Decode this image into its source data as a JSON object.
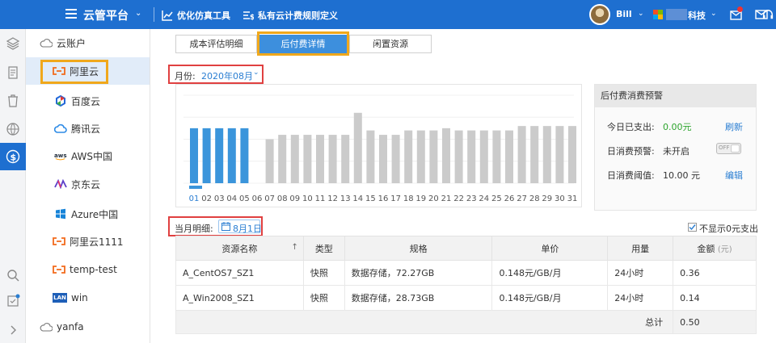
{
  "topbar": {
    "app_title": "云管平台",
    "tools": [
      {
        "label": "优化仿真工具",
        "icon": "chart-line-icon"
      },
      {
        "label": "私有云计费规则定义",
        "icon": "rule-list-icon"
      }
    ],
    "user_name": "Bill",
    "org_suffix": "科技"
  },
  "tree": {
    "root": "云账户",
    "items": [
      {
        "label": "阿里云",
        "icon": "aliyun-icon",
        "selected": true
      },
      {
        "label": "百度云",
        "icon": "baidu-cloud-icon"
      },
      {
        "label": "腾讯云",
        "icon": "tencent-cloud-icon"
      },
      {
        "label": "AWS中国",
        "icon": "aws-icon"
      },
      {
        "label": "京东云",
        "icon": "jd-cloud-icon"
      },
      {
        "label": "Azure中国",
        "icon": "azure-icon"
      },
      {
        "label": "阿里云1111",
        "icon": "aliyun-icon"
      },
      {
        "label": "temp-test",
        "icon": "aliyun-icon"
      },
      {
        "label": "win",
        "icon": "lan-icon"
      }
    ],
    "root2": "yanfa",
    "lan_text": "LAN"
  },
  "tabs": [
    {
      "label": "成本评估明细",
      "active": false
    },
    {
      "label": "后付费详情",
      "active": true
    },
    {
      "label": "闲置资源",
      "active": false
    }
  ],
  "month": {
    "label": "月份:",
    "value": "2020年08月"
  },
  "chart_data": {
    "type": "bar",
    "categories": [
      "01",
      "02",
      "03",
      "04",
      "05",
      "06",
      "07",
      "08",
      "09",
      "10",
      "11",
      "12",
      "13",
      "14",
      "15",
      "16",
      "17",
      "18",
      "19",
      "20",
      "21",
      "22",
      "23",
      "24",
      "25",
      "26",
      "27",
      "28",
      "29",
      "30",
      "31"
    ],
    "values": [
      0.5,
      0.5,
      0.5,
      0.5,
      0.5,
      0,
      0.4,
      0.44,
      0.44,
      0.44,
      0.44,
      0.44,
      0.44,
      0.64,
      0.48,
      0.44,
      0.44,
      0.48,
      0.48,
      0.48,
      0.5,
      0.48,
      0.48,
      0.48,
      0.48,
      0.48,
      0.52,
      0.52,
      0.52,
      0.52,
      0.52
    ],
    "highlighted_count": 5,
    "selected_category": "01",
    "colors": {
      "active": "#3b95db",
      "inactive": "#cbcbcb",
      "selected_label": "#2a7ed2",
      "label": "#555555"
    },
    "grid": true
  },
  "warning": {
    "title": "后付费消费预警",
    "rows": [
      {
        "key": "今日已支出:",
        "value": "0.00元",
        "action": "刷新"
      },
      {
        "key": "日消费预警:",
        "value": "未开启",
        "toggle_text": "OFF"
      },
      {
        "key": "日消费阈值:",
        "value": "10.00 元",
        "action": "编辑"
      }
    ]
  },
  "detail": {
    "label": "当月明细:",
    "date": "8月1日",
    "hide_zero_label": "不显示0元支出",
    "hide_zero_checked": true,
    "columns": [
      "资源名称",
      "类型",
      "规格",
      "单价",
      "用量",
      "金额"
    ],
    "amount_unit": "(元)",
    "rows": [
      {
        "name": "A_CentOS7_SZ1",
        "type": "快照",
        "spec": "数据存储，72.27GB",
        "price": "0.148元/GB/月",
        "usage": "24小时",
        "amount": "0.36"
      },
      {
        "name": "A_Win2008_SZ1",
        "type": "快照",
        "spec": "数据存储，28.73GB",
        "price": "0.148元/GB/月",
        "usage": "24小时",
        "amount": "0.14"
      }
    ],
    "total_label": "总计",
    "total_value": "0.50"
  }
}
